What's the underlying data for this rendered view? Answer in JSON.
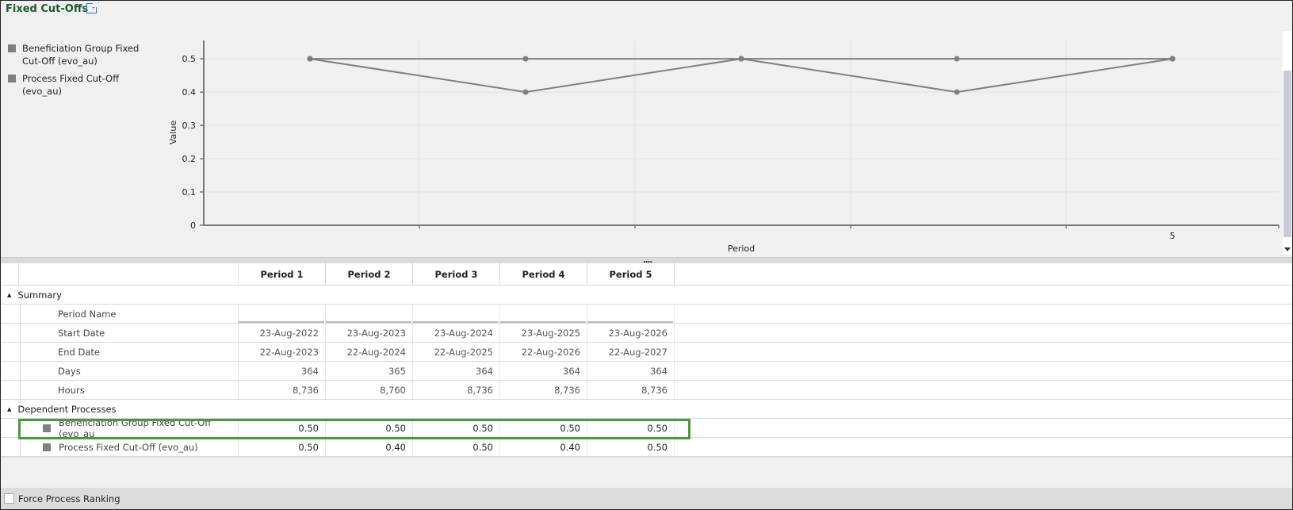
{
  "header": {
    "title": "Fixed Cut-Offs",
    "icon": "external-link-icon"
  },
  "chart_data": {
    "type": "line",
    "categories": [
      "1",
      "2",
      "3",
      "4",
      "5"
    ],
    "visible_x_tick_labels": [
      "5"
    ],
    "series": [
      {
        "name": "Beneficiation Group Fixed Cut-Off (evo_au)",
        "values": [
          0.5,
          0.5,
          0.5,
          0.5,
          0.5
        ],
        "color": "#7f7f7f"
      },
      {
        "name": "Process Fixed Cut-Off (evo_au)",
        "values": [
          0.5,
          0.4,
          0.5,
          0.4,
          0.5
        ],
        "color": "#7f7f7f"
      }
    ],
    "xlabel": "Period",
    "ylabel": "Value",
    "ylim": [
      0,
      0.555
    ],
    "yticks": [
      "0",
      "0.1",
      "0.2",
      "0.3",
      "0.4",
      "0.5"
    ],
    "grid": true,
    "legend": "left"
  },
  "table": {
    "headers": [
      "Period 1",
      "Period 2",
      "Period 3",
      "Period 4",
      "Period 5"
    ],
    "summary": {
      "label": "Summary",
      "rows": [
        {
          "label": "Period Name",
          "values": [
            "",
            "",
            "",
            "",
            ""
          ]
        },
        {
          "label": "Start Date",
          "values": [
            "23-Aug-2022",
            "23-Aug-2023",
            "23-Aug-2024",
            "23-Aug-2025",
            "23-Aug-2026"
          ]
        },
        {
          "label": "End Date",
          "values": [
            "22-Aug-2023",
            "22-Aug-2024",
            "22-Aug-2025",
            "22-Aug-2026",
            "22-Aug-2027"
          ]
        },
        {
          "label": "Days",
          "values": [
            "364",
            "365",
            "364",
            "364",
            "364"
          ]
        },
        {
          "label": "Hours",
          "values": [
            "8,736",
            "8,760",
            "8,736",
            "8,736",
            "8,736"
          ]
        }
      ]
    },
    "dependent": {
      "label": "Dependent Processes",
      "rows": [
        {
          "label": "Beneficiation Group Fixed Cut-Off (evo_au",
          "values": [
            "0.50",
            "0.50",
            "0.50",
            "0.50",
            "0.50"
          ]
        },
        {
          "label": "Process Fixed Cut-Off (evo_au)",
          "values": [
            "0.50",
            "0.40",
            "0.50",
            "0.40",
            "0.50"
          ]
        }
      ]
    }
  },
  "footer": {
    "force_ranking_label": "Force Process Ranking",
    "checked": false
  }
}
